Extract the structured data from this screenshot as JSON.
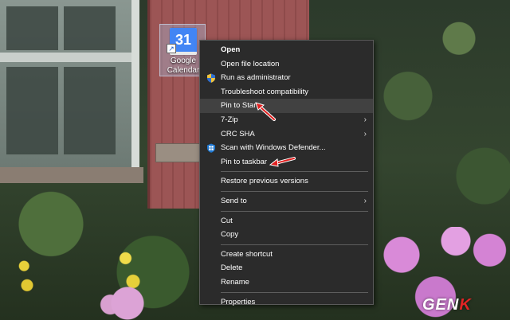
{
  "desktop_icon": {
    "label": "Google\nCalendar",
    "calendar_day": "31",
    "icon_name": "google-calendar-icon"
  },
  "context_menu": {
    "items": [
      {
        "label": "Open",
        "bold": true
      },
      {
        "label": "Open file location"
      },
      {
        "label": "Run as administrator",
        "icon": "uac-shield-icon"
      },
      {
        "label": "Troubleshoot compatibility"
      },
      {
        "label": "Pin to Start",
        "highlighted": true
      },
      {
        "label": "7-Zip",
        "submenu": true
      },
      {
        "label": "CRC SHA",
        "submenu": true
      },
      {
        "label": "Scan with Windows Defender...",
        "icon": "windows-defender-icon"
      },
      {
        "label": "Pin to taskbar"
      },
      {
        "label": "Restore previous versions"
      },
      {
        "label": "Send to",
        "submenu": true
      },
      {
        "label": "Cut"
      },
      {
        "label": "Copy"
      },
      {
        "label": "Create shortcut"
      },
      {
        "label": "Delete"
      },
      {
        "label": "Rename"
      },
      {
        "label": "Properties"
      }
    ],
    "submenu_glyph": "›"
  },
  "annotation_color": "#e02020",
  "watermark": {
    "prefix": "GEN",
    "suffix": "K"
  }
}
